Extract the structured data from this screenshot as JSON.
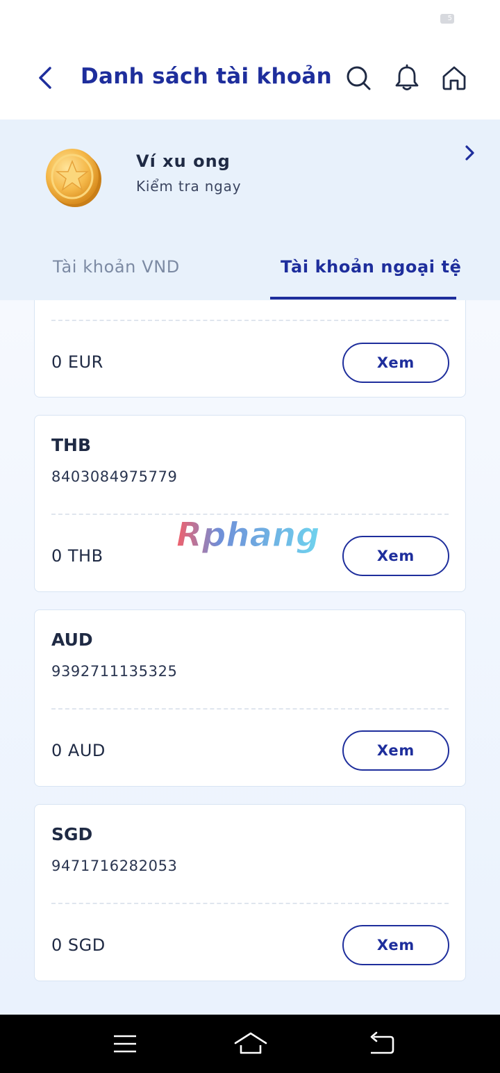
{
  "status_bar": {
    "battery_label": "5"
  },
  "header": {
    "title": "Danh sách tài khoản",
    "icons": [
      "back-icon",
      "search-icon",
      "bell-icon",
      "home-icon"
    ]
  },
  "wallet": {
    "title": "Ví xu ong",
    "subtitle": "Kiểm tra ngay",
    "icon": "coin-icon"
  },
  "tabs": [
    {
      "label": "Tài khoản VND",
      "active": false
    },
    {
      "label": "Tài khoản ngoại tệ",
      "active": true
    }
  ],
  "accounts": [
    {
      "currency": "",
      "account_number": "",
      "balance": "0 EUR",
      "button_label": "Xem"
    },
    {
      "currency": "THB",
      "account_number": "8403084975779",
      "balance": "0 THB",
      "button_label": "Xem"
    },
    {
      "currency": "AUD",
      "account_number": "9392711135325",
      "balance": "0 AUD",
      "button_label": "Xem"
    },
    {
      "currency": "SGD",
      "account_number": "9471716282053",
      "balance": "0 SGD",
      "button_label": "Xem"
    }
  ],
  "watermark": {
    "text": "Rphang"
  },
  "nav_bar": {
    "icons": [
      "menu-icon",
      "home-icon",
      "back-icon"
    ]
  },
  "colors": {
    "primary": "#1e2e9c",
    "banner_bg": "#e8f1fb",
    "card_border": "#d8e4f3"
  }
}
